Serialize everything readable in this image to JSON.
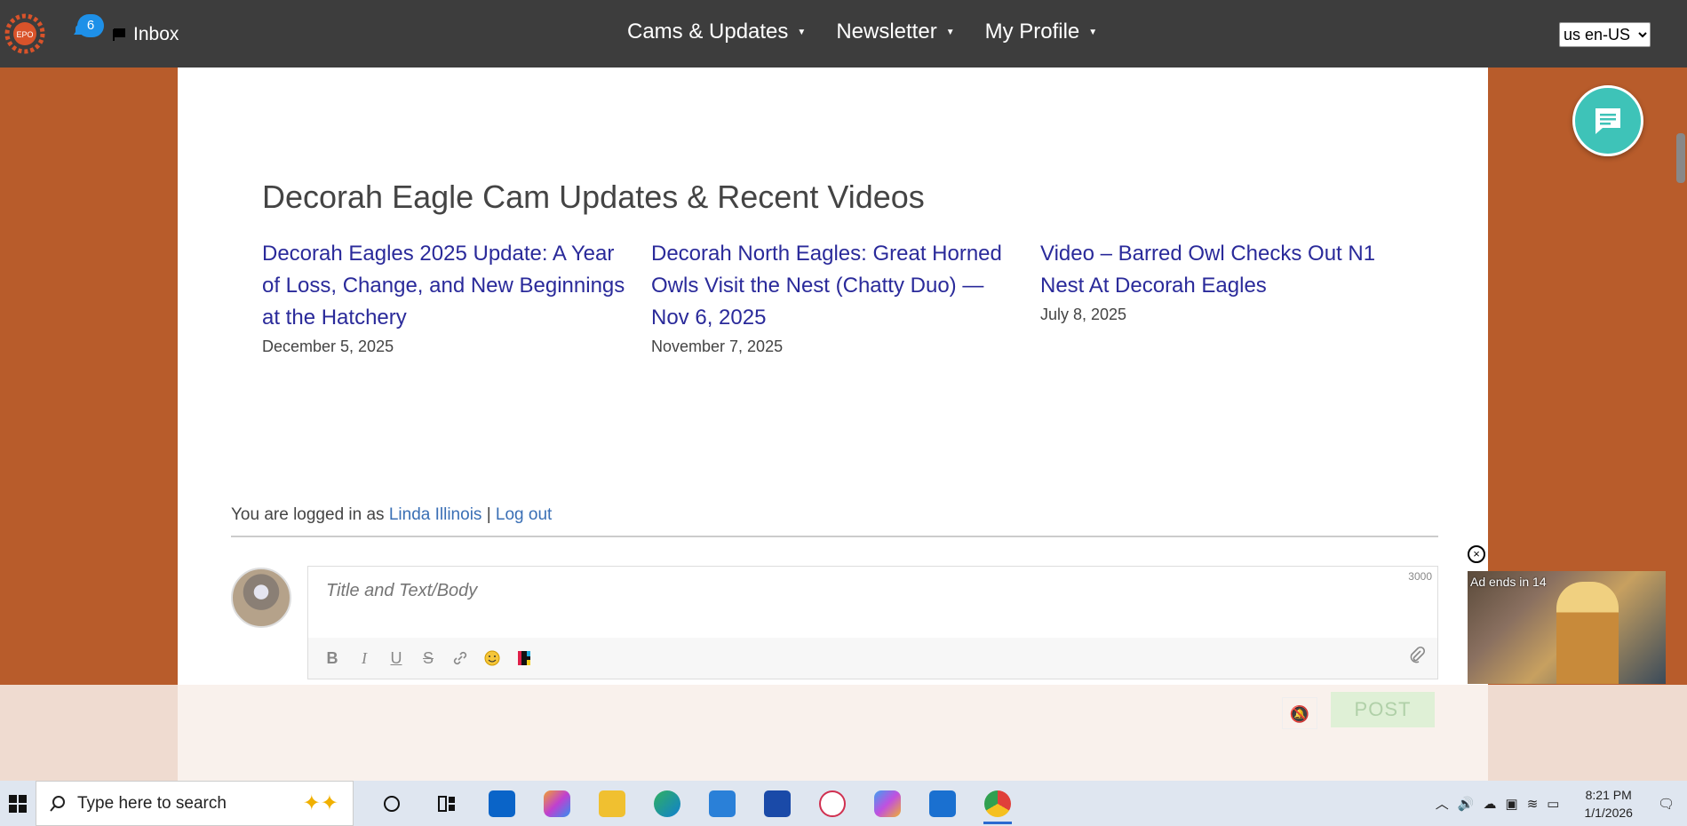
{
  "topbar": {
    "notif_count": "6",
    "inbox_label": "Inbox",
    "nav": [
      {
        "label": "Cams & Updates"
      },
      {
        "label": "Newsletter"
      },
      {
        "label": "My Profile"
      }
    ],
    "language": "us en-US"
  },
  "section": {
    "title": "Decorah Eagle Cam Updates & Recent Videos",
    "posts": [
      {
        "title": "Decorah Eagles 2025 Update: A Year of Loss, Change, and New Beginnings at the Hatchery",
        "date": "December 5, 2025"
      },
      {
        "title": "Decorah North Eagles: Great Horned Owls Visit the Nest (Chatty Duo) — Nov 6, 2025",
        "date": "November 7, 2025"
      },
      {
        "title": "Video – Barred Owl Checks Out N1 Nest At Decorah Eagles",
        "date": "July 8, 2025"
      }
    ]
  },
  "comments": {
    "logged_in_prefix": "You are logged in as",
    "user_name": "Linda Illinois",
    "separator": "|",
    "logout": "Log out",
    "placeholder": "Title and Text/Body",
    "char_limit": "3000",
    "post_button": "POST"
  },
  "ad": {
    "label": "Ad ends in 14",
    "close": "×"
  },
  "taskbar": {
    "search_placeholder": "Type here to search",
    "time": "8:21 PM",
    "date": "1/1/2026"
  }
}
